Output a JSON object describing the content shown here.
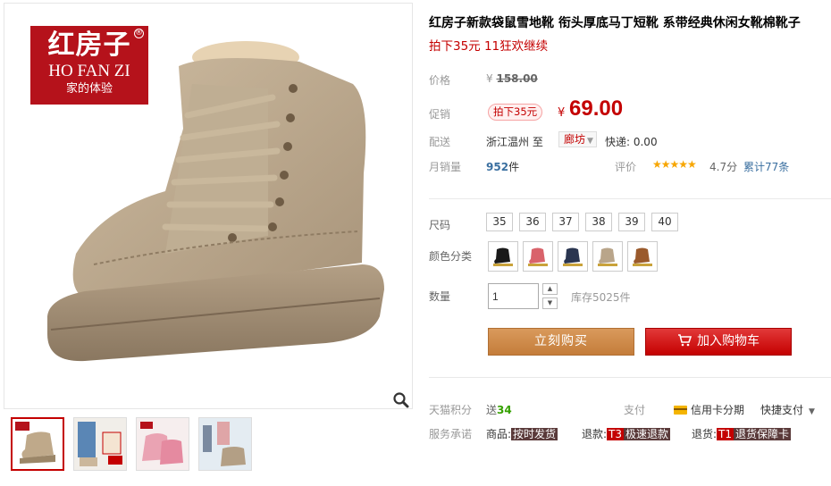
{
  "brand": {
    "name_cn": "红房子",
    "name_en": "HO FAN ZI",
    "tagline": "家的体验",
    "registered": "®"
  },
  "product": {
    "title": "红房子新款袋鼠雪地靴 衔头厚底马丁短靴 系带经典休闲女靴棉靴子",
    "subtitle": "拍下35元 11狂欢继续"
  },
  "price": {
    "label": "价格",
    "currency": "¥",
    "original": "158.00",
    "promo_label": "促销",
    "promo_badge": "拍下35元",
    "promo_price": "69.00"
  },
  "shipping": {
    "label": "配送",
    "from": "浙江温州 至",
    "to": "廊坊",
    "fee": "快递: 0.00"
  },
  "sales": {
    "label": "月销量",
    "count": "952",
    "unit": "件",
    "rating_label": "评价",
    "stars": "★★★★★",
    "score": "4.7分",
    "reviews": "累计77条"
  },
  "sizes": {
    "label": "尺码",
    "options": [
      "35",
      "36",
      "37",
      "38",
      "39",
      "40"
    ]
  },
  "colors": {
    "label": "颜色分类",
    "options": [
      {
        "name": "black",
        "hex": "#1a1a1a"
      },
      {
        "name": "pink",
        "hex": "#d9636b"
      },
      {
        "name": "navy",
        "hex": "#2a3550"
      },
      {
        "name": "khaki",
        "hex": "#b9a58a"
      },
      {
        "name": "brown",
        "hex": "#9a5a2c"
      }
    ]
  },
  "quantity": {
    "label": "数量",
    "value": "1",
    "stock": "库存5025件"
  },
  "actions": {
    "buy": "立刻购买",
    "cart": "加入购物车"
  },
  "points": {
    "label": "天猫积分",
    "prefix": "送",
    "value": "34"
  },
  "payment": {
    "label": "支付",
    "credit": "信用卡分期",
    "quick": "快捷支付"
  },
  "services": {
    "label": "服务承诺",
    "items": [
      {
        "prefix": "商品:",
        "tag": "按时发货"
      },
      {
        "prefix": "退款:",
        "code": "T3",
        "tag": "极速退款"
      },
      {
        "prefix": "退货:",
        "code": "T1",
        "tag": "退货保障卡"
      }
    ]
  },
  "colors_theme": {
    "accent": "#c40000",
    "buy_button": "#c88c52",
    "link": "#3a6fa0",
    "star": "#f7a600"
  }
}
